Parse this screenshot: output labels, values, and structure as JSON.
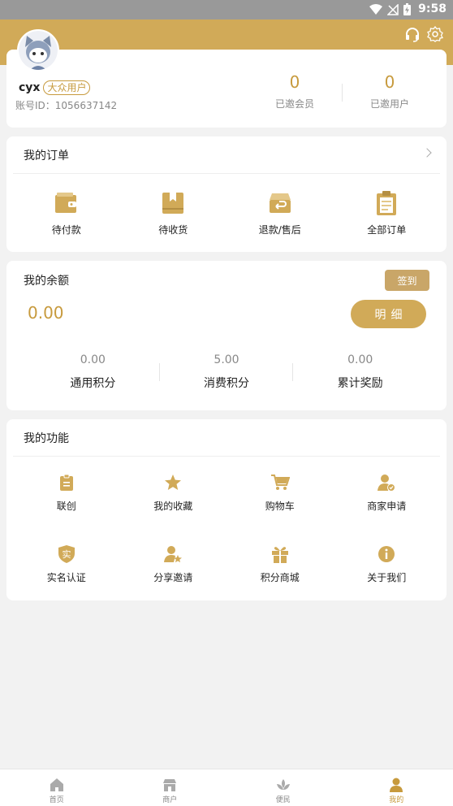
{
  "statusbar": {
    "time": "9:58"
  },
  "colors": {
    "accent": "#d1aa58",
    "accent_text": "#c79a3d",
    "background": "#f2f2f2"
  },
  "header": {
    "icons": [
      "headset-icon",
      "settings-icon"
    ]
  },
  "profile": {
    "username": "cyx",
    "user_tag": "大众用户",
    "account_id": "账号ID：1056637142",
    "stats": [
      {
        "value": "0",
        "label": "已邀会员"
      },
      {
        "value": "0",
        "label": "已邀用户"
      }
    ]
  },
  "orders": {
    "title": "我的订单",
    "items": [
      {
        "label": "待付款",
        "icon": "wallet-icon"
      },
      {
        "label": "待收货",
        "icon": "package-icon"
      },
      {
        "label": "退款/售后",
        "icon": "return-box-icon"
      },
      {
        "label": "全部订单",
        "icon": "clipboard-icon"
      }
    ]
  },
  "balance": {
    "title": "我的余额",
    "signin_label": "签到",
    "amount": "0.00",
    "detail_label": "明细",
    "points": [
      {
        "value": "0.00",
        "label": "通用积分"
      },
      {
        "value": "5.00",
        "label": "消费积分"
      },
      {
        "value": "0.00",
        "label": "累计奖励"
      }
    ]
  },
  "functions": {
    "title": "我的功能",
    "items": [
      {
        "label": "联创",
        "icon": "clipboard-list-icon"
      },
      {
        "label": "我的收藏",
        "icon": "star-icon"
      },
      {
        "label": "购物车",
        "icon": "cart-icon"
      },
      {
        "label": "商家申请",
        "icon": "merchant-user-icon"
      },
      {
        "label": "实名认证",
        "icon": "shield-verify-icon"
      },
      {
        "label": "分享邀请",
        "icon": "user-star-icon"
      },
      {
        "label": "积分商城",
        "icon": "gift-icon"
      },
      {
        "label": "关于我们",
        "icon": "info-icon"
      }
    ]
  },
  "tabbar": {
    "items": [
      {
        "label": "首页",
        "icon": "home-icon"
      },
      {
        "label": "商户",
        "icon": "store-icon"
      },
      {
        "label": "便民",
        "icon": "lotus-icon"
      },
      {
        "label": "我的",
        "icon": "user-icon"
      }
    ],
    "active_index": 3
  }
}
